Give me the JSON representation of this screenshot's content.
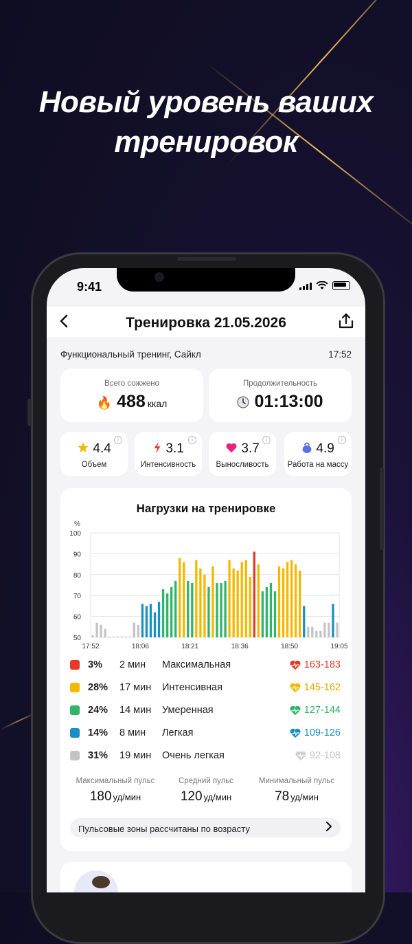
{
  "headline": [
    "Новый уровень ваших",
    "тренировок"
  ],
  "status_bar": {
    "time": "9:41"
  },
  "nav": {
    "title": "Тренировка 21.05.2026",
    "back_icon": "chevron-left-icon",
    "share_icon": "share-icon"
  },
  "workout": {
    "name": "Функциональный тренинг, Сайкл",
    "time": "17:52"
  },
  "calories": {
    "label": "Всего сожжено",
    "value": "488",
    "unit": "ккал",
    "icon": "fire-icon"
  },
  "duration": {
    "label": "Продолжительность",
    "value": "01:13:00",
    "icon": "clock-icon"
  },
  "metrics": [
    {
      "value": "4.4",
      "label": "Объем",
      "icon": "star-icon",
      "color": "#f5b800"
    },
    {
      "value": "3.1",
      "label": "Интенсивность",
      "icon": "lightning-icon",
      "color": "#e53a2b"
    },
    {
      "value": "3.7",
      "label": "Выносливость",
      "icon": "heart-icon",
      "color": "#e8247a"
    },
    {
      "value": "4.9",
      "label": "Работа на массу",
      "icon": "kettlebell-icon",
      "color": "#5a6fe0"
    }
  ],
  "chart_title": "Нагрузки на тренировке",
  "chart_data": {
    "type": "bar",
    "ylabel": "%",
    "ylim": [
      50,
      100
    ],
    "yticks": [
      "100",
      "90",
      "80",
      "70",
      "60",
      "50"
    ],
    "xticks": [
      "17:52",
      "18:06",
      "18:21",
      "18:36",
      "18:50",
      "19:05"
    ],
    "zone_colors": {
      "max": "#e53a2b",
      "intense": "#f5b800",
      "moderate": "#2fb46a",
      "light": "#1a8fc6",
      "very_light": "#c4c4c6"
    },
    "values": [
      51,
      57,
      56,
      54,
      50,
      50,
      50,
      50,
      50,
      50,
      57,
      56,
      66,
      65,
      66,
      62,
      67,
      73,
      71,
      74,
      77,
      88,
      86,
      77,
      76,
      87,
      83,
      80,
      74,
      84,
      76,
      76,
      77,
      87,
      83,
      82,
      86,
      87,
      79,
      91,
      85,
      72,
      74,
      76,
      72,
      84,
      83,
      86,
      87,
      85,
      82,
      65,
      55,
      55,
      53,
      53,
      57,
      57,
      66,
      57
    ],
    "zones": [
      "v",
      "v",
      "v",
      "v",
      "v",
      "v",
      "v",
      "v",
      "v",
      "v",
      "v",
      "v",
      "l",
      "l",
      "l",
      "l",
      "l",
      "m",
      "m",
      "m",
      "m",
      "i",
      "i",
      "m",
      "m",
      "i",
      "i",
      "i",
      "m",
      "i",
      "m",
      "m",
      "m",
      "i",
      "i",
      "i",
      "i",
      "i",
      "i",
      "x",
      "i",
      "m",
      "m",
      "m",
      "m",
      "i",
      "i",
      "i",
      "i",
      "i",
      "i",
      "l",
      "v",
      "v",
      "v",
      "v",
      "v",
      "v",
      "l",
      "v"
    ]
  },
  "zones_table": [
    {
      "pct": "3%",
      "duration": "2 мин",
      "name": "Максимальная",
      "range": "163-183",
      "color": "#e53a2b"
    },
    {
      "pct": "28%",
      "duration": "17 мин",
      "name": "Интенсивная",
      "range": "145-162",
      "color": "#f5b800"
    },
    {
      "pct": "24%",
      "duration": "14 мин",
      "name": "Умеренная",
      "range": "127-144",
      "color": "#2fb46a"
    },
    {
      "pct": "14%",
      "duration": "8 мин",
      "name": "Легкая",
      "range": "109-126",
      "color": "#1a8fc6"
    },
    {
      "pct": "31%",
      "duration": "19 мин",
      "name": "Очень легкая",
      "range": "92-108",
      "color": "#c4c4c6"
    }
  ],
  "pulse": {
    "max": {
      "label": "Максимальный пульс",
      "value": "180",
      "unit": "уд/мин"
    },
    "avg": {
      "label": "Средний пульс",
      "value": "120",
      "unit": "уд/мин"
    },
    "min": {
      "label": "Минимальный пульс",
      "value": "78",
      "unit": "уд/мин"
    }
  },
  "hint": {
    "text": "Пульсовые зоны рассчитаны по возрасту"
  }
}
